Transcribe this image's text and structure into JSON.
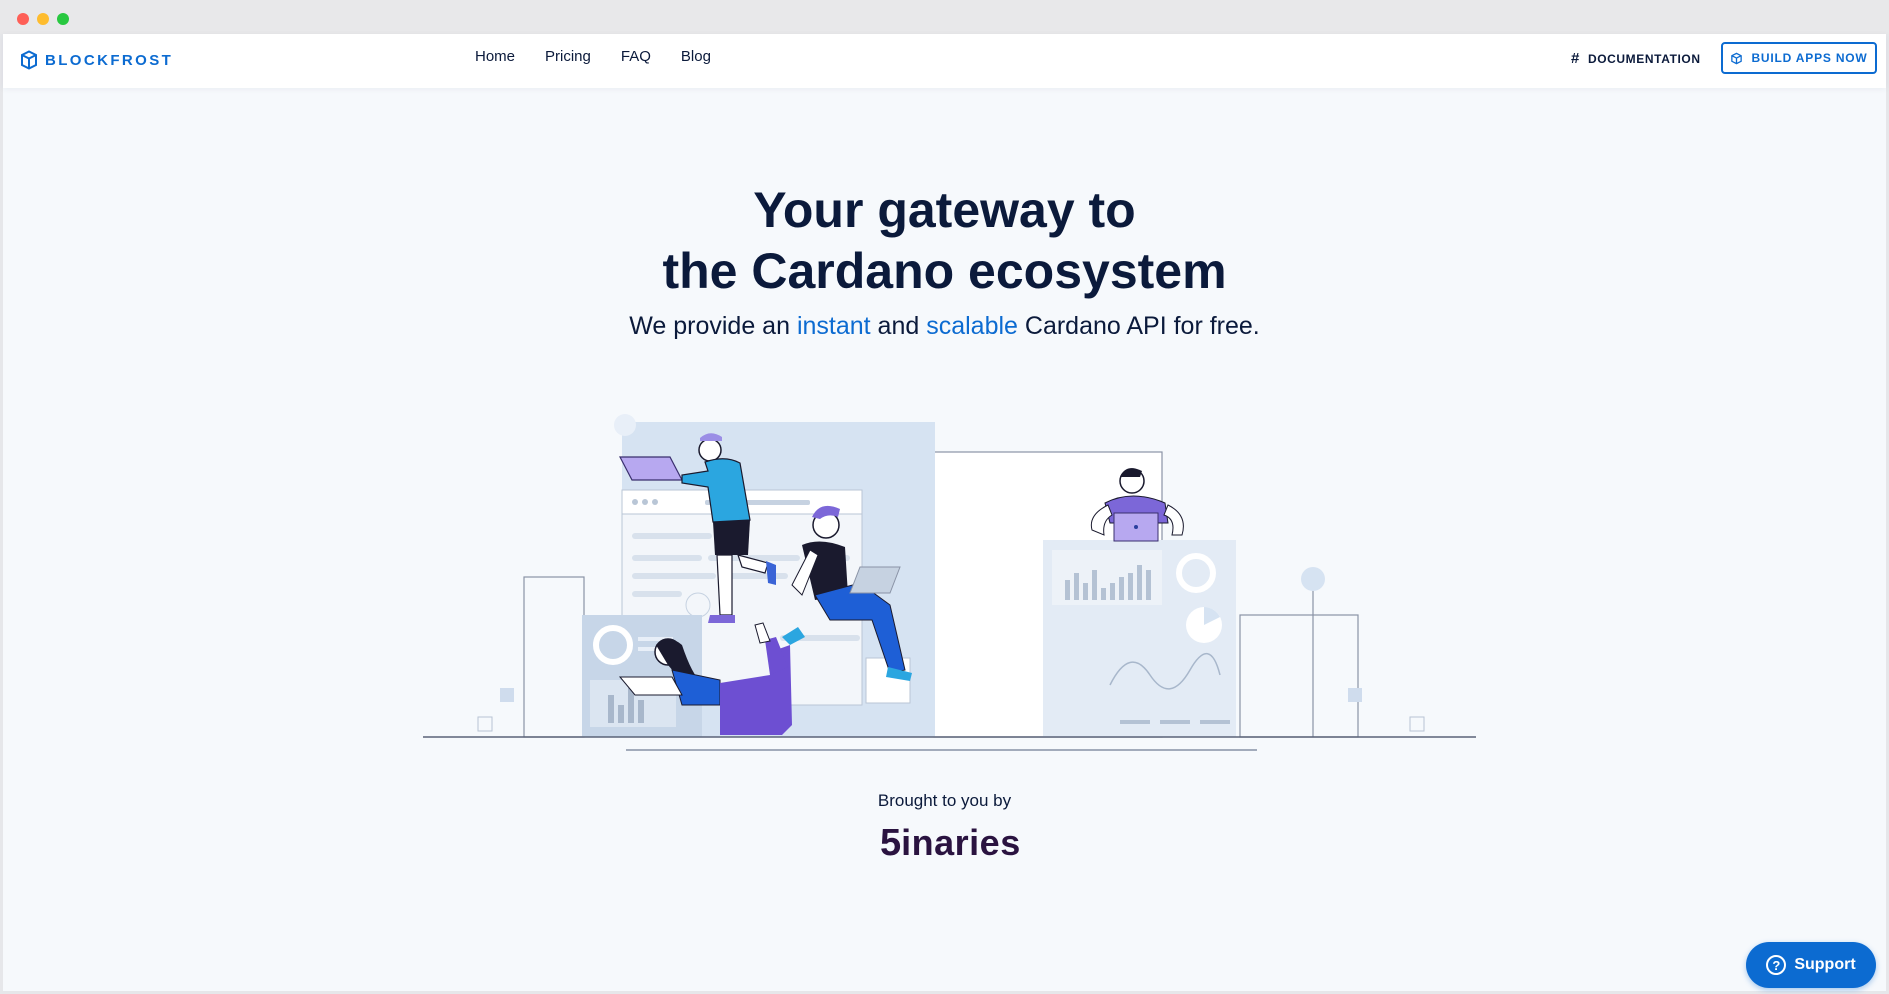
{
  "brand": {
    "name": "BLOCKFROST",
    "color": "#0c6bd1"
  },
  "nav": {
    "links": [
      {
        "label": "Home"
      },
      {
        "label": "Pricing"
      },
      {
        "label": "FAQ"
      },
      {
        "label": "Blog"
      }
    ],
    "documentation": {
      "icon": "#",
      "label": "DOCUMENTATION"
    },
    "cta": {
      "label": "BUILD APPS NOW",
      "icon": "cube-icon"
    }
  },
  "hero": {
    "title_line1": "Your gateway to",
    "title_line2": "the Cardano ecosystem",
    "subtitle": {
      "part1": "We provide an ",
      "highlight1": "instant",
      "part2": " and ",
      "highlight2": "scalable",
      "part3": " Cardano API for free."
    }
  },
  "credits": {
    "label": "Brought to you by",
    "company_logo": {
      "digit": "5",
      "text": "inaries"
    }
  },
  "support": {
    "label": "Support",
    "icon": "?"
  },
  "colors": {
    "accent": "#0c6bd1",
    "text_dark": "#0b1a3b",
    "background": "#f6f9fc",
    "illustration_purple": "#6d4fd2",
    "illustration_blue": "#1e88e5"
  }
}
